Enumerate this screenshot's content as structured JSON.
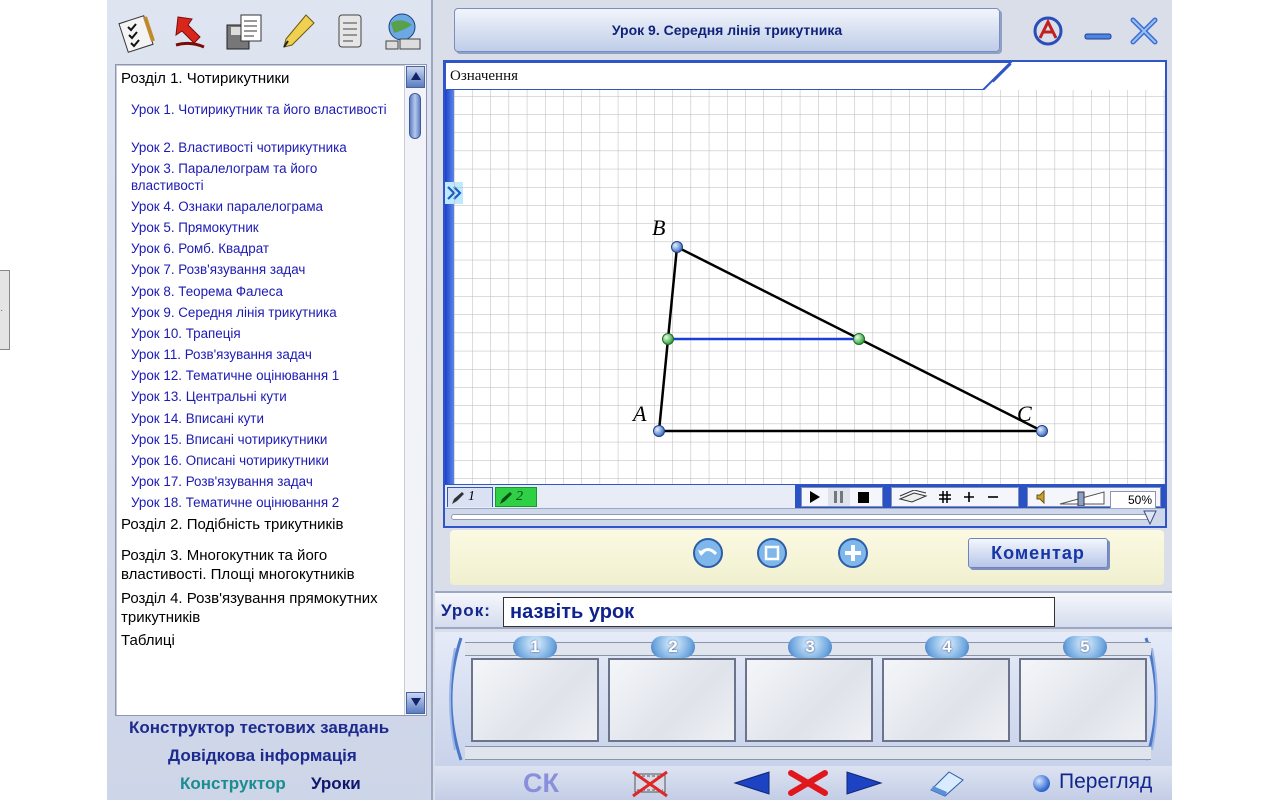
{
  "window": {
    "title": "Урок 9. Середня лінія трикутника"
  },
  "toolbar": {
    "icons": [
      "checklist-icon",
      "arrow-icon",
      "save-icon",
      "pen-icon",
      "document-icon",
      "network-icon"
    ]
  },
  "toc": {
    "sections": [
      {
        "label": "Розділ 1. Чотирикутники"
      },
      {
        "label": "Розділ 2. Подібність трикутників"
      },
      {
        "label": "Розділ 3. Многокутник та його властивості. Площі многокутників"
      },
      {
        "label": "Розділ 4. Розв'язування прямокутних трикутників"
      },
      {
        "label": "Таблиці"
      }
    ],
    "lessons": [
      {
        "label": "Урок 1. Чотирикутник та його властивості"
      },
      {
        "label": "Урок 2. Властивості чотирикутника"
      },
      {
        "label": "Урок 3. Паралелограм та його властивості"
      },
      {
        "label": "Урок 4. Ознаки паралелограма"
      },
      {
        "label": "Урок 5. Прямокутник"
      },
      {
        "label": "Урок 6. Ромб. Квадрат"
      },
      {
        "label": "Урок 7. Розв'язування задач"
      },
      {
        "label": "Урок 8. Теорема Фалеса"
      },
      {
        "label": "Урок 9. Середня лінія трикутника"
      },
      {
        "label": "Урок 10. Трапеція"
      },
      {
        "label": "Урок 11. Розв'язування задач"
      },
      {
        "label": "Урок 12. Тематичне оцінювання 1"
      },
      {
        "label": "Урок 13. Центральні кути"
      },
      {
        "label": "Урок 14. Вписані кути"
      },
      {
        "label": "Урок 15. Вписані чотирикутники"
      },
      {
        "label": "Урок 16. Описані чотирикутники"
      },
      {
        "label": "Урок 17. Розв'язування задач"
      },
      {
        "label": "Урок 18. Тематичне оцінювання 2"
      }
    ]
  },
  "left_links": {
    "constructor_tests": "Конструктор тестових завдань",
    "help": "Довідкова інформація",
    "constructor": "Конструктор",
    "lessons": "Уроки"
  },
  "board": {
    "header": "Означення",
    "points": {
      "A": "A",
      "B": "B",
      "C": "C"
    },
    "tabs": [
      "1",
      "2"
    ],
    "zoom": "50%"
  },
  "actions": {
    "comment": "Коментар"
  },
  "lesson": {
    "label": "Урок:",
    "placeholder": "назвіть урок"
  },
  "film": {
    "frames": [
      "1",
      "2",
      "3",
      "4",
      "5"
    ]
  },
  "bottom": {
    "ck": "СК",
    "preview": "Перегляд"
  },
  "colors": {
    "board_border": "#2f55c8",
    "lesson_link": "#1c1ab4",
    "midline": "#1c3fd8"
  }
}
